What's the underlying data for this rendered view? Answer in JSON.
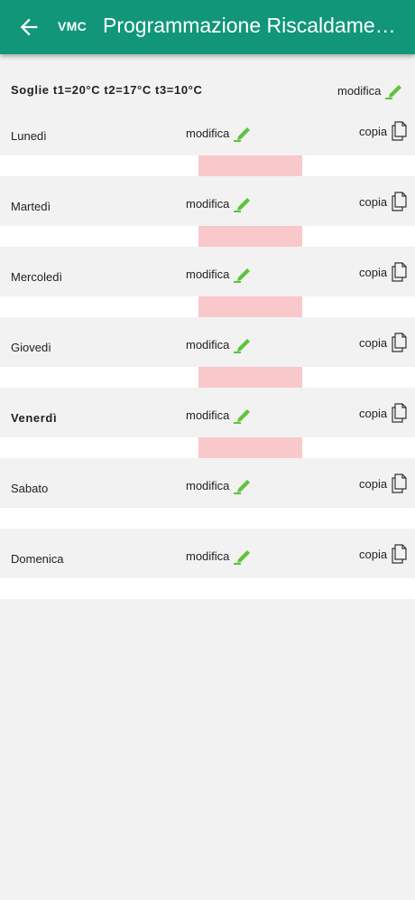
{
  "header": {
    "back_icon": "arrow-left-icon",
    "badge": "VMC",
    "title": "Programmazione Riscaldame…"
  },
  "thresholds": {
    "label": "Soglie t1=20°C t2=17°C t3=10°C",
    "edit_label": "modifica"
  },
  "colors": {
    "appbar": "#11967a",
    "accent_green": "#5cc43a",
    "slot_t1": "#f8c8cb",
    "background": "#f2f2f2"
  },
  "days": [
    {
      "name": "Lunedì",
      "edit_label": "modifica",
      "copy_label": "copia",
      "bold": false,
      "slots": [
        {
          "start_hour": 11.5,
          "end_hour": 17.5
        }
      ]
    },
    {
      "name": "Martedì",
      "edit_label": "modifica",
      "copy_label": "copia",
      "bold": false,
      "slots": [
        {
          "start_hour": 11.5,
          "end_hour": 17.5
        }
      ]
    },
    {
      "name": "Mercoledì",
      "edit_label": "modifica",
      "copy_label": "copia",
      "bold": false,
      "slots": [
        {
          "start_hour": 11.5,
          "end_hour": 17.5
        }
      ]
    },
    {
      "name": "Giovedì",
      "edit_label": "modifica",
      "copy_label": "copia",
      "bold": false,
      "slots": [
        {
          "start_hour": 11.5,
          "end_hour": 17.5
        }
      ]
    },
    {
      "name": "Venerdì",
      "edit_label": "modifica",
      "copy_label": "copia",
      "bold": true,
      "slots": [
        {
          "start_hour": 11.5,
          "end_hour": 17.5
        }
      ]
    },
    {
      "name": "Sabato",
      "edit_label": "modifica",
      "copy_label": "copia",
      "bold": false,
      "slots": []
    },
    {
      "name": "Domenica",
      "edit_label": "modifica",
      "copy_label": "copia",
      "bold": false,
      "slots": []
    }
  ]
}
